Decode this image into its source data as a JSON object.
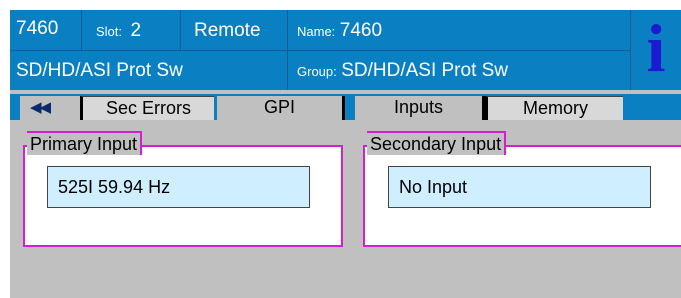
{
  "header": {
    "model": "7460",
    "slot_label": "Slot:",
    "slot_value": "2",
    "mode": "Remote",
    "name_label": "Name:",
    "name_value": "7460",
    "description": "SD/HD/ASI Prot Sw",
    "group_label": "Group:",
    "group_value": "SD/HD/ASI Prot Sw",
    "info_icon": "i"
  },
  "tabs": {
    "back_arrows": "◀◀",
    "items": [
      "Sec Errors",
      "GPI",
      "Inputs",
      "Memory"
    ]
  },
  "panels": {
    "primary": {
      "title": "Primary Input",
      "value": "525I 59.94 Hz"
    },
    "secondary": {
      "title": "Secondary Input",
      "value": "No Input"
    }
  },
  "colors": {
    "header_bg": "#0a7fc2",
    "body_bg": "#c0c0c0",
    "panel_border": "#d020d0",
    "value_bg": "#cfeeff",
    "info_icon": "#1a1ad0"
  }
}
